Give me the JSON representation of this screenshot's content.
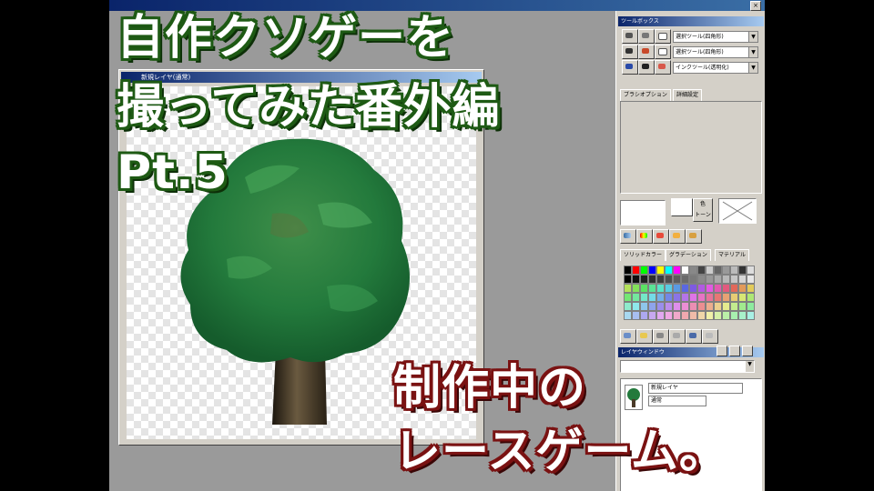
{
  "overlay": {
    "title_lines": [
      "自作クソゲーを",
      "撮ってみた番外編",
      "Pt.5"
    ],
    "subtitle_lines": [
      "制作中の",
      "レースゲーム。"
    ],
    "colors": {
      "title_outline": "#1e5a14",
      "subtitle_outline": "#7a1212",
      "text_fill": "#ffffff"
    }
  },
  "app": {
    "close_glyph": "×",
    "canvas_window": {
      "title": "新規レイヤ(通常)"
    },
    "toolbox": {
      "title": "ツールボックス",
      "dropdowns": [
        "選択ツール(四角形)",
        "選択ツール(四角形)",
        "インクツール(透明化)"
      ],
      "tabs": [
        "ブラシオプション",
        "詳細設定"
      ]
    },
    "color_panel": {
      "swatch_label": "色",
      "swatch_label2": "トーン",
      "tabs": [
        "ソリッドカラー",
        "グラデーション",
        "マテリアル"
      ]
    },
    "layer_panel": {
      "title": "レイヤウィンドウ",
      "rows": [
        "新規レイヤ",
        "通常"
      ]
    }
  }
}
